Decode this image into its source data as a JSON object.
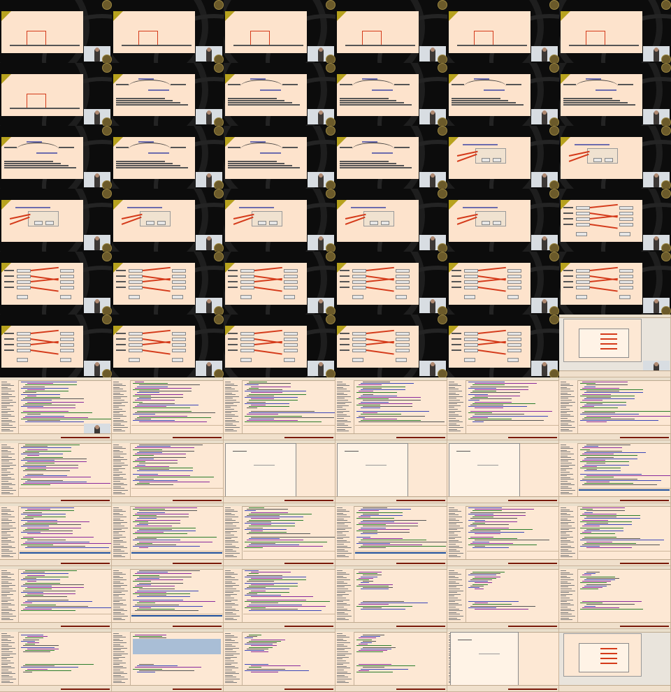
{
  "sheet": {
    "title": "",
    "columns": 6,
    "rows": 11,
    "colors": {
      "lecture_background": "#0c0c0c",
      "slide_background": "#fde3cc",
      "screen_background": "#fde8d4",
      "accent_red": "#d43a1a",
      "logo_olive": "#b7a21e",
      "code_blue": "#3b46b8",
      "code_purple": "#8a2a9c",
      "code_green": "#2b7d2b",
      "selection_blue": "#a9bed6",
      "status_blue": "#1e4f9c"
    }
  },
  "tiles": [
    {
      "kind": "lecture",
      "variant": "code"
    },
    {
      "kind": "lecture",
      "variant": "code"
    },
    {
      "kind": "lecture",
      "variant": "code"
    },
    {
      "kind": "lecture",
      "variant": "code"
    },
    {
      "kind": "lecture",
      "variant": "code"
    },
    {
      "kind": "lecture",
      "variant": "code"
    },
    {
      "kind": "lecture",
      "variant": "code"
    },
    {
      "kind": "lecture",
      "variant": "arc"
    },
    {
      "kind": "lecture",
      "variant": "arc"
    },
    {
      "kind": "lecture",
      "variant": "arc"
    },
    {
      "kind": "lecture",
      "variant": "arc"
    },
    {
      "kind": "lecture",
      "variant": "arc"
    },
    {
      "kind": "lecture",
      "variant": "arc"
    },
    {
      "kind": "lecture",
      "variant": "arc"
    },
    {
      "kind": "lecture",
      "variant": "arc"
    },
    {
      "kind": "lecture",
      "variant": "arc"
    },
    {
      "kind": "lecture",
      "variant": "dialog"
    },
    {
      "kind": "lecture",
      "variant": "dialog"
    },
    {
      "kind": "lecture",
      "variant": "dialog"
    },
    {
      "kind": "lecture",
      "variant": "dialog"
    },
    {
      "kind": "lecture",
      "variant": "dialog"
    },
    {
      "kind": "lecture",
      "variant": "dialog"
    },
    {
      "kind": "lecture",
      "variant": "dialog"
    },
    {
      "kind": "lecture",
      "variant": "form"
    },
    {
      "kind": "lecture",
      "variant": "form"
    },
    {
      "kind": "lecture",
      "variant": "form"
    },
    {
      "kind": "lecture",
      "variant": "form"
    },
    {
      "kind": "lecture",
      "variant": "form"
    },
    {
      "kind": "lecture",
      "variant": "form"
    },
    {
      "kind": "lecture",
      "variant": "form"
    },
    {
      "kind": "lecture",
      "variant": "form"
    },
    {
      "kind": "lecture",
      "variant": "form"
    },
    {
      "kind": "lecture",
      "variant": "form"
    },
    {
      "kind": "lecture",
      "variant": "form"
    },
    {
      "kind": "lecture",
      "variant": "form"
    },
    {
      "kind": "screen",
      "variant": "desktop"
    },
    {
      "kind": "screen",
      "variant": "ide-cam"
    },
    {
      "kind": "screen",
      "variant": "ide"
    },
    {
      "kind": "screen",
      "variant": "ide"
    },
    {
      "kind": "screen",
      "variant": "ide"
    },
    {
      "kind": "screen",
      "variant": "ide"
    },
    {
      "kind": "screen",
      "variant": "ide"
    },
    {
      "kind": "screen",
      "variant": "ide"
    },
    {
      "kind": "screen",
      "variant": "ide"
    },
    {
      "kind": "screen",
      "variant": "window"
    },
    {
      "kind": "screen",
      "variant": "window"
    },
    {
      "kind": "screen",
      "variant": "window"
    },
    {
      "kind": "screen",
      "variant": "ide-blue"
    },
    {
      "kind": "screen",
      "variant": "ide-blue"
    },
    {
      "kind": "screen",
      "variant": "ide-blue"
    },
    {
      "kind": "screen",
      "variant": "ide"
    },
    {
      "kind": "screen",
      "variant": "ide-blue"
    },
    {
      "kind": "screen",
      "variant": "ide"
    },
    {
      "kind": "screen",
      "variant": "ide"
    },
    {
      "kind": "screen",
      "variant": "ide"
    },
    {
      "kind": "screen",
      "variant": "ide-blue"
    },
    {
      "kind": "screen",
      "variant": "ide"
    },
    {
      "kind": "screen",
      "variant": "log"
    },
    {
      "kind": "screen",
      "variant": "log"
    },
    {
      "kind": "screen",
      "variant": "log"
    },
    {
      "kind": "screen",
      "variant": "log"
    },
    {
      "kind": "screen",
      "variant": "log-selected"
    },
    {
      "kind": "screen",
      "variant": "log"
    },
    {
      "kind": "screen",
      "variant": "log"
    },
    {
      "kind": "screen",
      "variant": "window-small"
    },
    {
      "kind": "screen",
      "variant": "desktop-end"
    }
  ]
}
